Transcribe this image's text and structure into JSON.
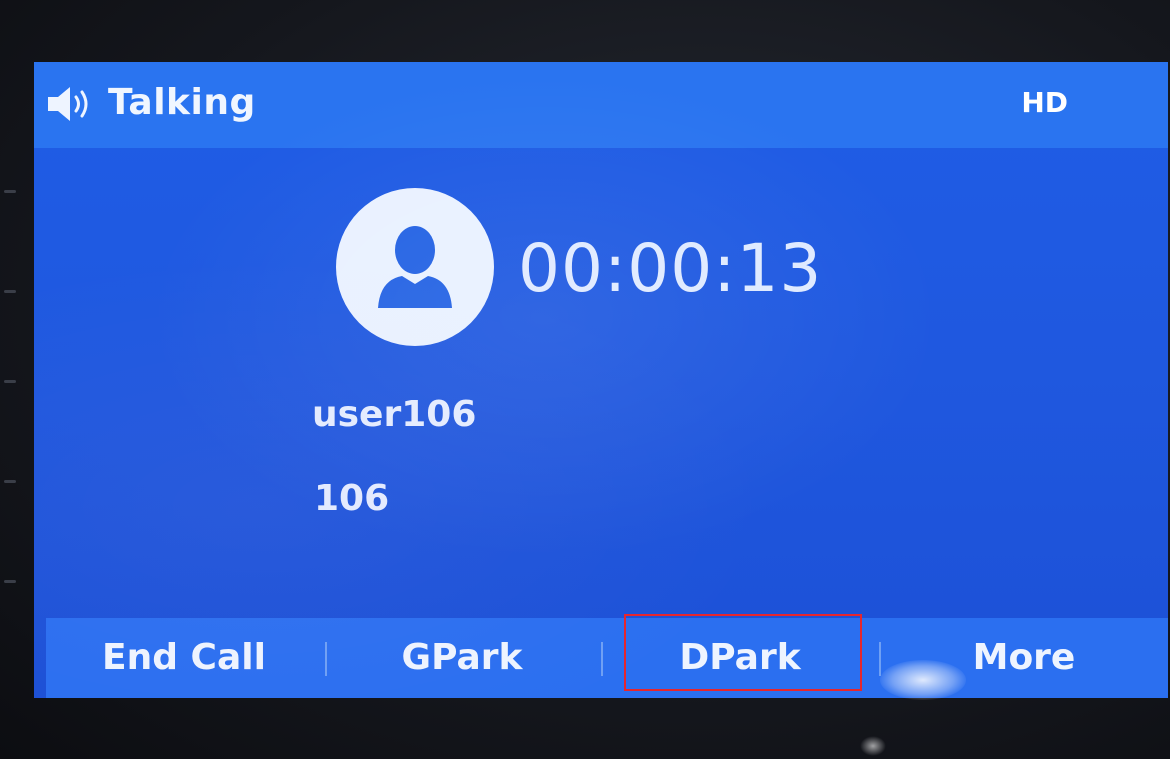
{
  "status_bar": {
    "icon": "speaker-icon",
    "title": "Talking",
    "badge": "HD"
  },
  "call": {
    "avatar_icon": "person-icon",
    "timer": "00:00:13",
    "caller_name": "user106",
    "caller_number": "106"
  },
  "softkeys": [
    {
      "label": "End Call"
    },
    {
      "label": "GPark"
    },
    {
      "label": "DPark"
    },
    {
      "label": "More"
    }
  ],
  "highlighted_softkey": "DPark",
  "colors": {
    "screen_bg": "#1f5de6",
    "bar_bg": "#2a74f0",
    "highlight": "#e6262e",
    "text": "#eef4ff"
  }
}
